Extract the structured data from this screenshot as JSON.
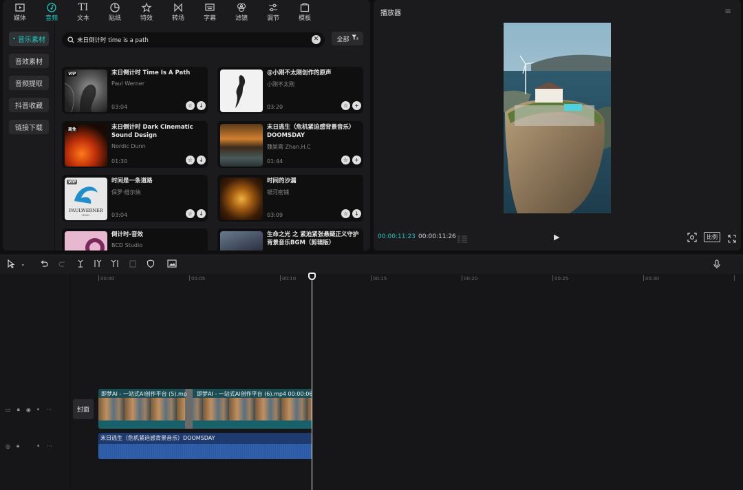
{
  "top_tabs": [
    {
      "label": "媒体",
      "icon": "media-icon"
    },
    {
      "label": "音频",
      "icon": "audio-icon",
      "active": true
    },
    {
      "label": "文本",
      "icon": "text-icon"
    },
    {
      "label": "贴纸",
      "icon": "sticker-icon"
    },
    {
      "label": "特效",
      "icon": "effects-icon"
    },
    {
      "label": "转场",
      "icon": "transition-icon"
    },
    {
      "label": "字幕",
      "icon": "subtitle-icon"
    },
    {
      "label": "滤镜",
      "icon": "filter-icon"
    },
    {
      "label": "调节",
      "icon": "adjust-icon"
    },
    {
      "label": "模板",
      "icon": "template-icon"
    }
  ],
  "sidebar": {
    "items": [
      {
        "label": "音乐素材",
        "active": true
      },
      {
        "label": "音效素材"
      },
      {
        "label": "音频提取"
      },
      {
        "label": "抖音收藏"
      },
      {
        "label": "链接下载"
      }
    ]
  },
  "search": {
    "value": "末日倒计时 time is a path",
    "filter_label": "全部"
  },
  "cards": [
    {
      "title": "末日倒计时  Time Is A Path",
      "artist": "Paul Werner",
      "duration": "03:04",
      "badge": "VIP"
    },
    {
      "title": "@小刚不太刚创作的原声",
      "artist": "小刚不太刚",
      "duration": "03:20",
      "badge": ""
    },
    {
      "title": "末日倒计时  Dark Cinematic Sound Design",
      "artist": "Nordic Dunn",
      "duration": "01:30",
      "badge": "商免"
    },
    {
      "title": "末日逃生（危机紧迫感背景音乐）DOOMSDAY",
      "artist": "魏吴霄 Zhan.H.C",
      "duration": "01:44",
      "badge": ""
    },
    {
      "title": "时间是一条道路",
      "artist": "保罗·维尔纳",
      "duration": "03:04",
      "badge": "VIP"
    },
    {
      "title": "时间的沙漏",
      "artist": "银河密铺",
      "duration": "03:09",
      "badge": ""
    },
    {
      "title": "倒计时-音效",
      "artist": "BCD Studio",
      "duration": "",
      "badge": ""
    },
    {
      "title": "生命之光 之 紧迫紧张悬疑正义守护背景音乐BGM（剪辑版）",
      "artist": "",
      "duration": "",
      "badge": ""
    }
  ],
  "player": {
    "title": "播放器",
    "time_current": "00:00:11:23",
    "time_total": "00:00:11:26",
    "ratio_label": "比例"
  },
  "ruler": [
    "00:00",
    "00:05",
    "00:10",
    "00:15",
    "00:20",
    "00:25",
    "00:30"
  ],
  "timeline": {
    "cover_label": "封面",
    "video_clip_1": "即梦AI - 一站式AI创作平台 (5).mp",
    "video_clip_2": "即梦AI - 一站式AI创作平台 (6).mp4   00:00:06",
    "audio_clip": "末日逃生（危机紧迫感背景音乐）DOOMSDAY"
  },
  "colors": {
    "accent": "#21c8c3",
    "panel": "#1b1b1d",
    "video_clip": "#1a4e54",
    "audio_clip": "#1f3a6f"
  }
}
